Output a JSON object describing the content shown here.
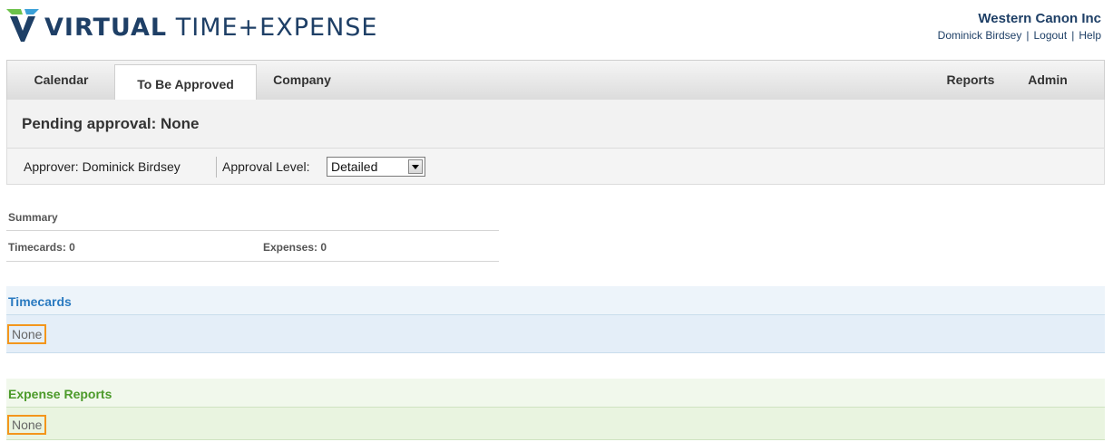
{
  "logo": {
    "brand": "VIRTUAL",
    "product": "TIME+EXPENSE",
    "icon": "v-logo-icon"
  },
  "account": {
    "company": "Western Canon Inc",
    "user": "Dominick Birdsey",
    "logout": "Logout",
    "help": "Help",
    "separator": "|"
  },
  "nav": {
    "tabs": [
      {
        "label": "Calendar"
      },
      {
        "label": "To Be Approved",
        "active": true
      },
      {
        "label": "Company"
      }
    ],
    "right_tabs": [
      {
        "label": "Reports"
      },
      {
        "label": "Admin"
      }
    ]
  },
  "page": {
    "title": "Pending approval: None"
  },
  "filter": {
    "approver": "Approver: Dominick Birdsey",
    "level_label": "Approval Level:",
    "level_value": "Detailed"
  },
  "summary": {
    "title": "Summary",
    "timecards": "Timecards:  0",
    "expenses": "Expenses:  0"
  },
  "timecards": {
    "title": "Timecards",
    "empty": "None"
  },
  "expenses": {
    "title": "Expense Reports",
    "empty": "None"
  },
  "colors": {
    "brand_navy": "#1e3f66",
    "timecards_accent": "#2a7ac0",
    "expenses_accent": "#4c9a2a",
    "highlight": "#f3961c"
  }
}
